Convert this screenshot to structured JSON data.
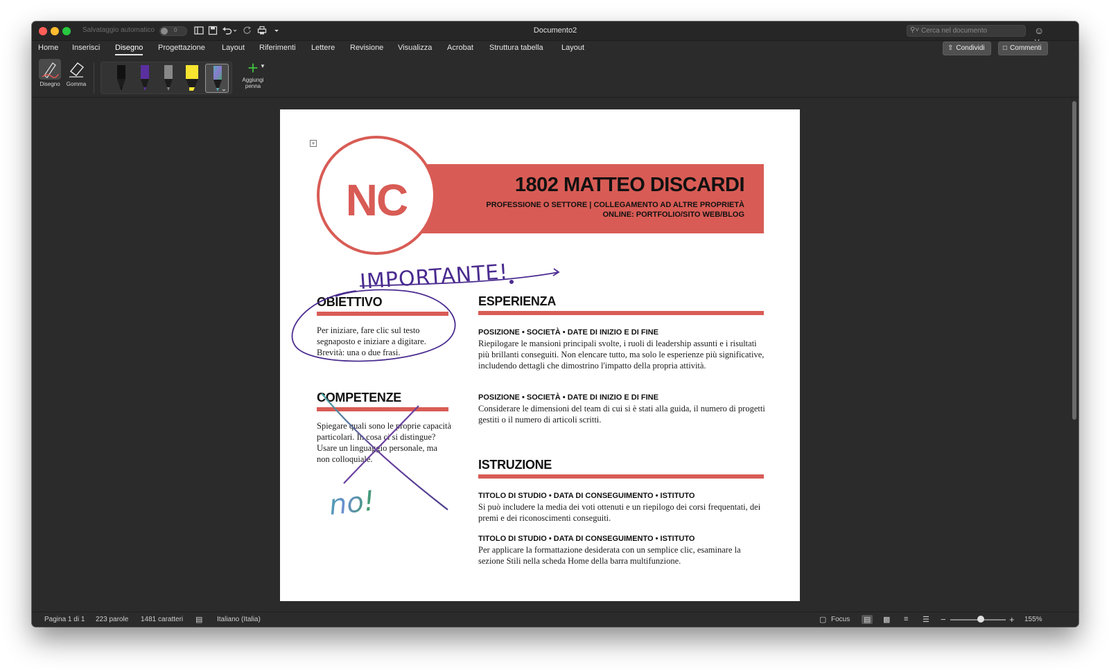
{
  "window": {
    "title": "Documento2",
    "autosave_label": "Salvataggio automatico",
    "autosave_state": "0",
    "search_placeholder": "Cerca nel documento"
  },
  "ribbon": {
    "tabs": [
      {
        "label": "Home"
      },
      {
        "label": "Inserisci"
      },
      {
        "label": "Disegno",
        "active": true
      },
      {
        "label": "Progettazione"
      },
      {
        "label": "Layout"
      },
      {
        "label": "Riferimenti"
      },
      {
        "label": "Lettere"
      },
      {
        "label": "Revisione"
      },
      {
        "label": "Visualizza"
      },
      {
        "label": "Acrobat"
      },
      {
        "label": "Struttura tabella"
      },
      {
        "label": "Layout"
      }
    ],
    "share_label": "Condividi",
    "comments_label": "Commenti",
    "tools": {
      "draw_label": "Disegno",
      "eraser_label": "Gomma",
      "add_pen_label_1": "Aggiungi",
      "add_pen_label_2": "penna"
    },
    "pen_colors": [
      "#111111",
      "#5b2fa0",
      "#888888",
      "#f7e531",
      "#5aa9b8"
    ]
  },
  "document": {
    "monogram": "NC",
    "name": "1802 MATTEO DISCARDI",
    "subtitle_line1": "PROFESSIONE O SETTORE | COLLEGAMENTO AD ALTRE PROPRIETÀ",
    "subtitle_line2": "ONLINE: PORTFOLIO/SITO WEB/BLOG",
    "objective": {
      "heading": "OBIETTIVO",
      "text": "Per iniziare, fare clic sul testo segnaposto e iniziare a digitare. Brevità: una o due frasi."
    },
    "skills": {
      "heading": "COMPETENZE",
      "text": "Spiegare quali sono le proprie capacità particolari. In cosa ci si distingue? Usare un linguaggio personale, ma non colloquiale."
    },
    "experience": {
      "heading": "ESPERIENZA",
      "entries": [
        {
          "head": "POSIZIONE • SOCIETÀ • DATE DI INIZIO E DI FINE",
          "text": "Riepilogare le mansioni principali svolte, i ruoli di leadership assunti e i risultati più brillanti conseguiti.  Non elencare tutto, ma solo le esperienze più significative, includendo dettagli che dimostrino l'impatto della propria attività."
        },
        {
          "head": "POSIZIONE • SOCIETÀ • DATE DI INIZIO E DI FINE",
          "text": "Considerare le dimensioni del team di cui si è stati alla guida, il numero di progetti gestiti o il numero di articoli scritti."
        }
      ]
    },
    "education": {
      "heading": "ISTRUZIONE",
      "entries": [
        {
          "head": "TITOLO DI STUDIO • DATA DI CONSEGUIMENTO • ISTITUTO",
          "text": "Si può includere la media dei voti ottenuti e un riepilogo dei corsi frequentati, dei premi e dei riconoscimenti conseguiti."
        },
        {
          "head": "TITOLO DI STUDIO • DATA DI CONSEGUIMENTO • ISTITUTO",
          "text": "Per applicare la formattazione desiderata con un semplice clic, esaminare la sezione Stili nella scheda Home della barra multifunzione."
        }
      ]
    },
    "ink": {
      "annotation_1": "IMPORTANTE!",
      "annotation_2": "no!"
    }
  },
  "status": {
    "page": "Pagina 1 di 1",
    "words": "223 parole",
    "chars": "1481 caratteri",
    "language": "Italiano (Italia)",
    "focus_label": "Focus",
    "zoom": "155%",
    "zoom_level_percent": 55
  }
}
